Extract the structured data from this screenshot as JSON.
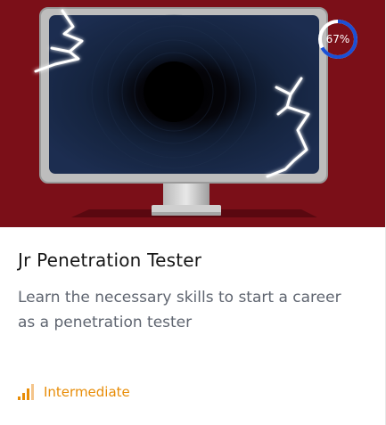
{
  "course": {
    "title": "Jr Penetration Tester",
    "description": "Learn the necessary skills to start a career as a penetration tester",
    "progress_label": "67%",
    "progress_fraction": 0.67,
    "difficulty": "Intermediate"
  },
  "colors": {
    "hero_background": "#7b0f18",
    "progress_ring": "#1a4fd6",
    "difficulty": "#e88d08"
  },
  "icons": {
    "difficulty": "signal-bars-icon",
    "hero": "monitor-illustration"
  }
}
